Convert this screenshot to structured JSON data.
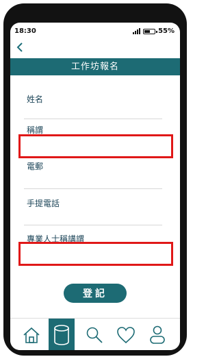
{
  "status": {
    "time": "18:30",
    "battery": "55%"
  },
  "header": {
    "title": "工作坊報名"
  },
  "form": {
    "fields": [
      {
        "label": "姓名"
      },
      {
        "label": "稱謂"
      },
      {
        "label": "電郵"
      },
      {
        "label": "手提電話"
      },
      {
        "label": "專業人士稱講謂"
      }
    ],
    "submit_label": "登記"
  },
  "colors": {
    "accent": "#1d6b74",
    "highlight": "#e01818"
  },
  "nav": {
    "items": [
      {
        "icon": "home-icon"
      },
      {
        "icon": "database-icon"
      },
      {
        "icon": "search-icon"
      },
      {
        "icon": "heart-icon"
      },
      {
        "icon": "user-icon"
      }
    ],
    "active_index": 1
  }
}
